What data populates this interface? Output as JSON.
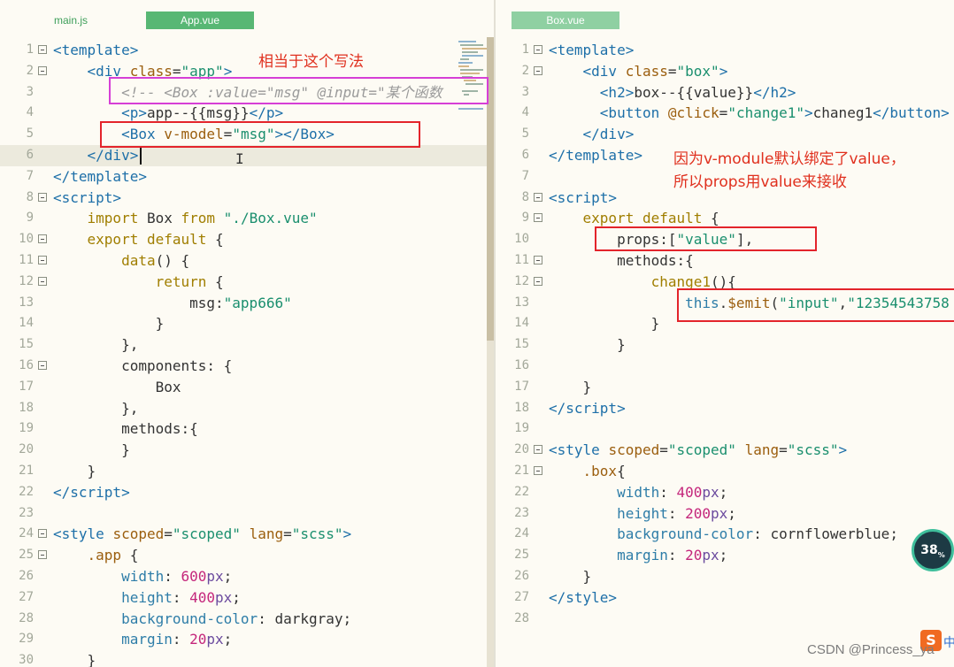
{
  "left_pane": {
    "tabs": [
      {
        "label": "main.js",
        "active": false
      },
      {
        "label": "App.vue",
        "active": true
      }
    ],
    "lines": [
      {
        "n": "1",
        "fold": true,
        "html": "<span class='t'>&lt;template&gt;</span>"
      },
      {
        "n": "2",
        "fold": true,
        "html": "    <span class='t'>&lt;div</span> <span class='a'>class</span>=<span class='s'>\"app\"</span><span class='t'>&gt;</span>"
      },
      {
        "n": "3",
        "fold": false,
        "html": "        <span class='cmt'>&lt;!-- &lt;Box :value=\"msg\" @input=\"某个函数</span>"
      },
      {
        "n": "4",
        "fold": false,
        "html": "        <span class='t'>&lt;p&gt;</span>app--{{msg}}<span class='t'>&lt;/p&gt;</span>"
      },
      {
        "n": "5",
        "fold": false,
        "html": "        <span class='t'>&lt;Box</span> <span class='a'>v-model</span>=<span class='s'>\"msg\"</span><span class='t'>&gt;&lt;/Box&gt;</span>"
      },
      {
        "n": "6",
        "fold": false,
        "html": "    <span class='t'>&lt;/div&gt;</span>"
      },
      {
        "n": "7",
        "fold": false,
        "html": "<span class='t'>&lt;/template&gt;</span>"
      },
      {
        "n": "8",
        "fold": true,
        "html": "<span class='t'>&lt;script&gt;</span>"
      },
      {
        "n": "9",
        "fold": false,
        "html": "    <span class='k'>import</span> Box <span class='k'>from</span> <span class='s'>\"./Box.vue\"</span>"
      },
      {
        "n": "10",
        "fold": true,
        "html": "    <span class='k'>export default</span> {"
      },
      {
        "n": "11",
        "fold": true,
        "html": "        <span class='k'>data</span>() {"
      },
      {
        "n": "12",
        "fold": true,
        "html": "            <span class='k'>return</span> {"
      },
      {
        "n": "13",
        "fold": false,
        "html": "                msg:<span class='s'>\"app666\"</span>"
      },
      {
        "n": "14",
        "fold": false,
        "html": "            }"
      },
      {
        "n": "15",
        "fold": false,
        "html": "        },"
      },
      {
        "n": "16",
        "fold": true,
        "html": "        components: {"
      },
      {
        "n": "17",
        "fold": false,
        "html": "            Box"
      },
      {
        "n": "18",
        "fold": false,
        "html": "        },"
      },
      {
        "n": "19",
        "fold": false,
        "html": "        methods:{"
      },
      {
        "n": "20",
        "fold": false,
        "html": "        }"
      },
      {
        "n": "21",
        "fold": false,
        "html": "    }"
      },
      {
        "n": "22",
        "fold": false,
        "html": "<span class='t'>&lt;/script&gt;</span>"
      },
      {
        "n": "23",
        "fold": false,
        "html": ""
      },
      {
        "n": "24",
        "fold": true,
        "html": "<span class='t'>&lt;style</span> <span class='a'>scoped</span>=<span class='s'>\"scoped\"</span> <span class='a'>lang</span>=<span class='s'>\"scss\"</span><span class='t'>&gt;</span>"
      },
      {
        "n": "25",
        "fold": true,
        "html": "    <span class='a'>.app</span> {"
      },
      {
        "n": "26",
        "fold": false,
        "html": "        <span class='tt'>width</span>: <span class='n'>600</span><span class='p'>px</span>;"
      },
      {
        "n": "27",
        "fold": false,
        "html": "        <span class='tt'>height</span>: <span class='n'>400</span><span class='p'>px</span>;"
      },
      {
        "n": "28",
        "fold": false,
        "html": "        <span class='tt'>background-color</span>: darkgray;"
      },
      {
        "n": "29",
        "fold": false,
        "html": "        <span class='tt'>margin</span>: <span class='n'>20</span><span class='p'>px</span>;"
      },
      {
        "n": "30",
        "fold": false,
        "html": "    }"
      }
    ],
    "annotation": "相当于这个写法"
  },
  "right_pane": {
    "tabs": [
      {
        "label": "Box.vue",
        "active": true
      }
    ],
    "lines": [
      {
        "n": "1",
        "fold": true,
        "html": "<span class='t'>&lt;template&gt;</span>"
      },
      {
        "n": "2",
        "fold": true,
        "html": "    <span class='t'>&lt;div</span> <span class='a'>class</span>=<span class='s'>\"box\"</span><span class='t'>&gt;</span>"
      },
      {
        "n": "3",
        "fold": false,
        "html": "      <span class='t'>&lt;h2&gt;</span>box--{{value}}<span class='t'>&lt;/h2&gt;</span>"
      },
      {
        "n": "4",
        "fold": false,
        "html": "      <span class='t'>&lt;button</span> <span class='a'>@click</span>=<span class='s'>\"change1\"</span><span class='t'>&gt;</span>chaneg1<span class='t'>&lt;/button&gt;</span>"
      },
      {
        "n": "5",
        "fold": false,
        "html": "    <span class='t'>&lt;/div&gt;</span>"
      },
      {
        "n": "6",
        "fold": false,
        "html": "<span class='t'>&lt;/template&gt;</span>"
      },
      {
        "n": "7",
        "fold": false,
        "html": ""
      },
      {
        "n": "8",
        "fold": true,
        "html": "<span class='t'>&lt;script&gt;</span>"
      },
      {
        "n": "9",
        "fold": true,
        "html": "    <span class='k'>export default</span> {"
      },
      {
        "n": "10",
        "fold": false,
        "html": "        props:[<span class='s'>\"value\"</span>],"
      },
      {
        "n": "11",
        "fold": true,
        "html": "        methods:{"
      },
      {
        "n": "12",
        "fold": true,
        "html": "            <span class='k'>change1</span>(){"
      },
      {
        "n": "13",
        "fold": false,
        "html": "                <span class='tt'>this</span>.<span class='a'>$emit</span>(<span class='s'>\"input\"</span>,<span class='s'>\"12354543758</span>"
      },
      {
        "n": "14",
        "fold": false,
        "html": "            }"
      },
      {
        "n": "15",
        "fold": false,
        "html": "        }"
      },
      {
        "n": "16",
        "fold": false,
        "html": ""
      },
      {
        "n": "17",
        "fold": false,
        "html": "    }"
      },
      {
        "n": "18",
        "fold": false,
        "html": "<span class='t'>&lt;/script&gt;</span>"
      },
      {
        "n": "19",
        "fold": false,
        "html": ""
      },
      {
        "n": "20",
        "fold": true,
        "html": "<span class='t'>&lt;style</span> <span class='a'>scoped</span>=<span class='s'>\"scoped\"</span> <span class='a'>lang</span>=<span class='s'>\"scss\"</span><span class='t'>&gt;</span>"
      },
      {
        "n": "21",
        "fold": true,
        "html": "    <span class='a'>.box</span>{"
      },
      {
        "n": "22",
        "fold": false,
        "html": "        <span class='tt'>width</span>: <span class='n'>400</span><span class='p'>px</span>;"
      },
      {
        "n": "23",
        "fold": false,
        "html": "        <span class='tt'>height</span>: <span class='n'>200</span><span class='p'>px</span>;"
      },
      {
        "n": "24",
        "fold": false,
        "html": "        <span class='tt'>background-color</span>: cornflowerblue;"
      },
      {
        "n": "25",
        "fold": false,
        "html": "        <span class='tt'>margin</span>: <span class='n'>20</span><span class='p'>px</span>;"
      },
      {
        "n": "26",
        "fold": false,
        "html": "    }"
      },
      {
        "n": "27",
        "fold": false,
        "html": "<span class='t'>&lt;/style&gt;</span>"
      },
      {
        "n": "28",
        "fold": false,
        "html": ""
      }
    ],
    "annotation_line1": "因为v-module默认绑定了value，",
    "annotation_line2": "所以props用value来接收"
  },
  "overlay": {
    "gauge_value": "38",
    "gauge_unit": "%",
    "watermark": "CSDN @Princess_ya",
    "ime_label": "S",
    "ime_label2": "中"
  },
  "colors": {
    "accent_tab": "#58b774",
    "annotation_red": "#e0301e",
    "highlight_box_red": "#e3242b",
    "highlight_box_magenta": "#d63fd6",
    "editor_bg": "#fdfbf4"
  }
}
